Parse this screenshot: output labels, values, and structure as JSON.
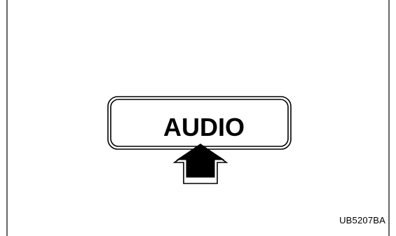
{
  "button": {
    "label": "AUDIO"
  },
  "figure_code": "UB5207BA",
  "colors": {
    "line": "#000000",
    "background": "#ffffff"
  },
  "icons": {
    "arrow": "press-arrow-icon"
  }
}
